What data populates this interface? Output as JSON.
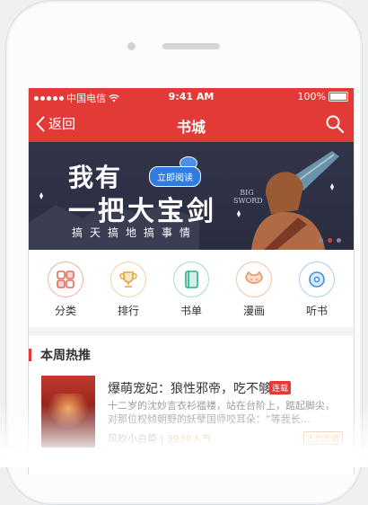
{
  "status": {
    "carrier": "中国电信",
    "time": "9:41 AM",
    "battery": "100%"
  },
  "nav": {
    "back_label": "返回",
    "title": "书城",
    "search_icon": "search-icon"
  },
  "banner": {
    "line1": "我有",
    "line2": "一把大宝剑",
    "subtitle": "搞天搞地搞事情",
    "pill": "立即阅读",
    "logo_text": "BIG SWORD",
    "page_count": 3,
    "active_page": 1
  },
  "categories": [
    {
      "label": "分类",
      "icon": "category-grid-icon",
      "color": "#e46b5c"
    },
    {
      "label": "排行",
      "icon": "trophy-icon",
      "color": "#e8a23c"
    },
    {
      "label": "书单",
      "icon": "book-icon",
      "color": "#2fae8a"
    },
    {
      "label": "漫画",
      "icon": "cat-face-icon",
      "color": "#e8905a"
    },
    {
      "label": "听书",
      "icon": "disc-icon",
      "color": "#3c8ee0"
    }
  ],
  "hot": {
    "title": "本周热推",
    "book": {
      "title": "爆萌宠妃：狼性邪帝，吃不够",
      "serial_tag": "连载",
      "description": "十二岁的沈妙言衣衫褴褛，站在台阶上，踮起脚尖，对那位权倾朝野的妖孽国师咬耳朵：“等我长…",
      "author": "风吹小白菜",
      "heat": "3930人气",
      "genre_tag": "古代言情"
    }
  },
  "colors": {
    "brand": "#e23a36"
  }
}
